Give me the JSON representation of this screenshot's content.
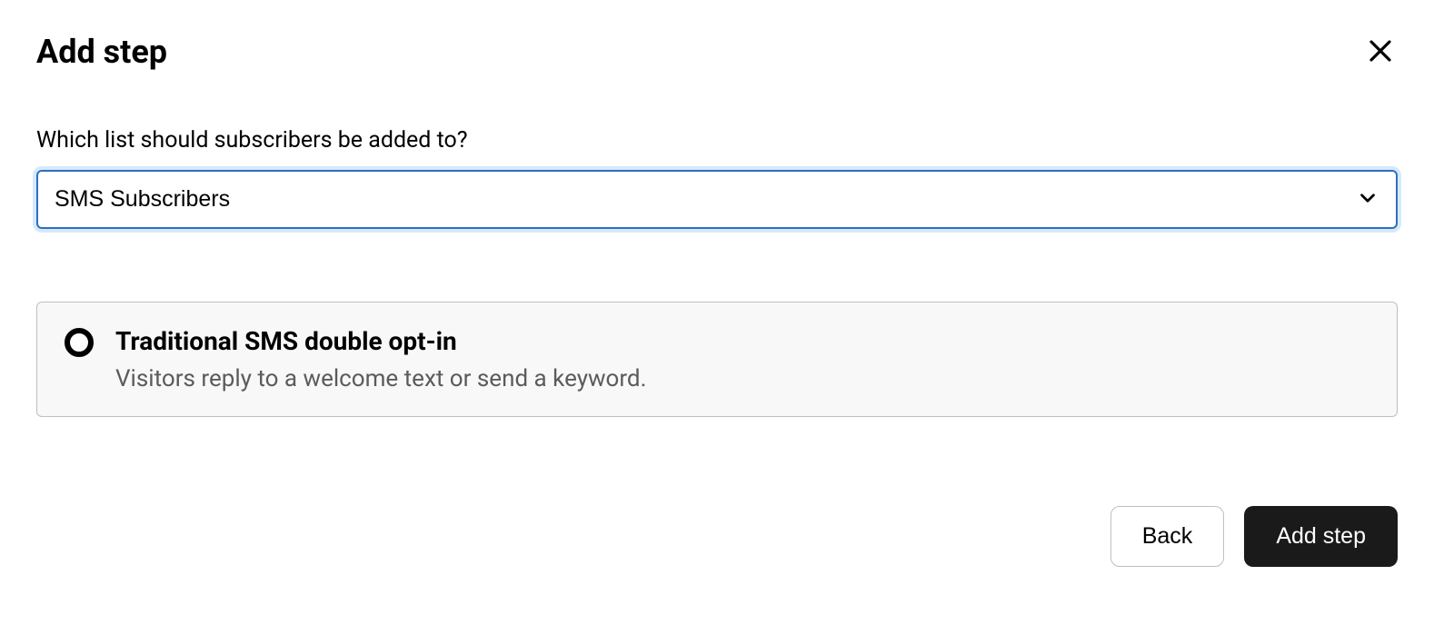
{
  "header": {
    "title": "Add step"
  },
  "form": {
    "list_label": "Which list should subscribers be added to?",
    "list_selected": "SMS Subscribers"
  },
  "option": {
    "title": "Traditional SMS double opt-in",
    "description": "Visitors reply to a welcome text or send a keyword."
  },
  "footer": {
    "back_label": "Back",
    "add_step_label": "Add step"
  }
}
